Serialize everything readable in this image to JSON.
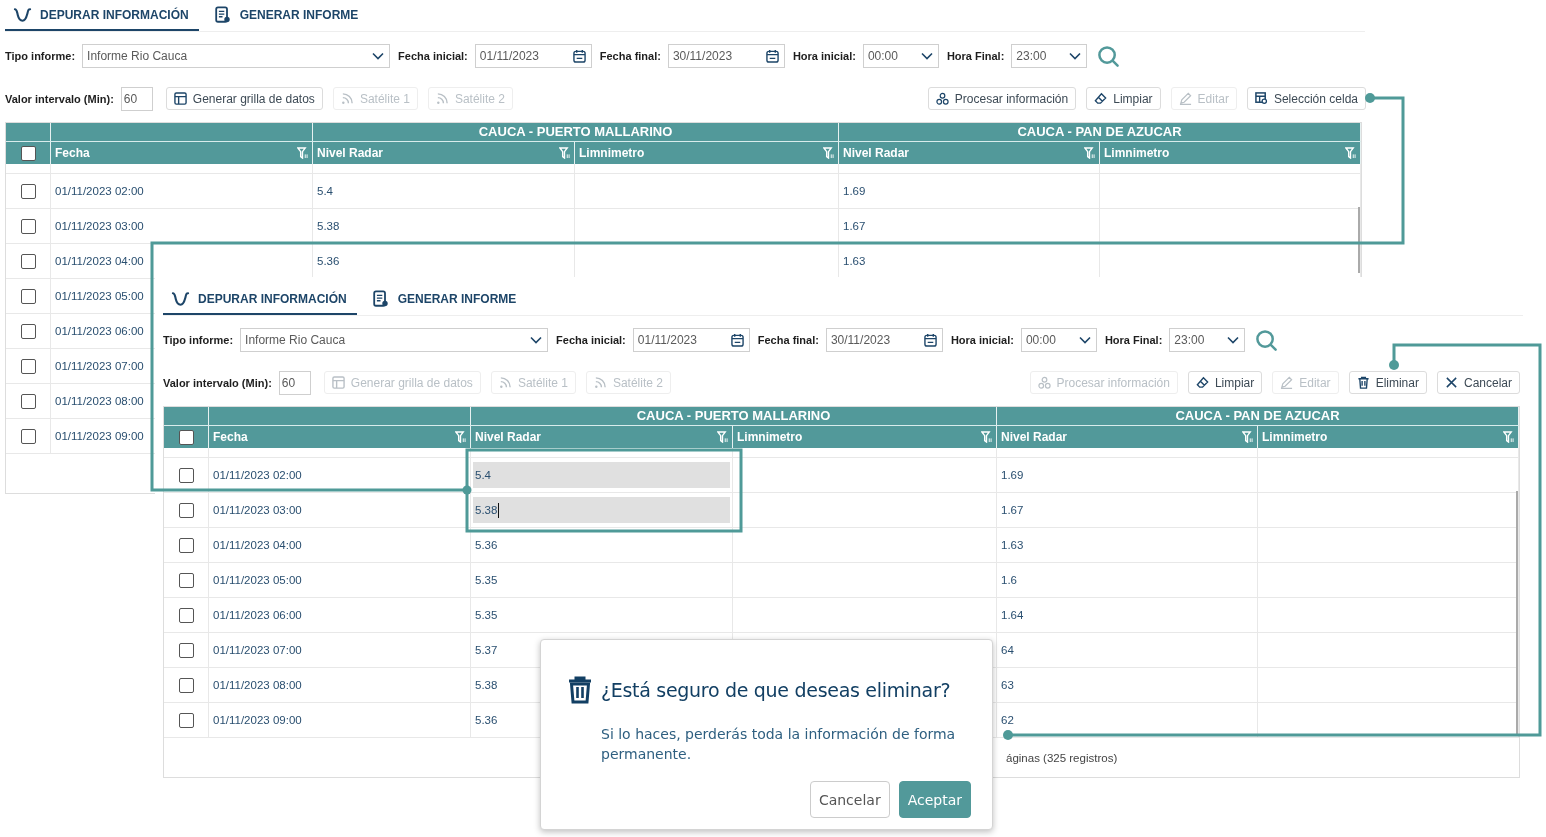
{
  "panels": [
    {
      "tabs": [
        {
          "label": "DEPURAR INFORMACIÓN",
          "selected": true
        },
        {
          "label": "GENERAR INFORME",
          "selected": false
        }
      ],
      "filters": [
        {
          "label": "Tipo informe:",
          "value": "Informe Rio Cauca",
          "kind": "select"
        },
        {
          "label": "Fecha inicial:",
          "value": "01/11/2023",
          "kind": "date"
        },
        {
          "label": "Fecha final:",
          "value": "30/11/2023",
          "kind": "date"
        },
        {
          "label": "Hora inicial:",
          "value": "00:00",
          "kind": "select"
        },
        {
          "label": "Hora Final:",
          "value": "23:00",
          "kind": "select"
        }
      ],
      "interval": {
        "label": "Valor intervalo (Min):",
        "value": "60"
      },
      "left_buttons": [
        {
          "label": "Generar grilla de datos",
          "kind": "grid",
          "disabled": false
        },
        {
          "label": "Satélite 1",
          "kind": "signal",
          "disabled": true
        },
        {
          "label": "Satélite 2",
          "kind": "signal",
          "disabled": true
        }
      ],
      "right_buttons": [
        {
          "label": "Procesar información",
          "kind": "process",
          "disabled": false
        },
        {
          "label": "Limpiar",
          "kind": "eraser",
          "disabled": false
        },
        {
          "label": "Editar",
          "kind": "pencil",
          "disabled": true
        },
        {
          "label": "Selección celda",
          "kind": "select",
          "disabled": false
        }
      ],
      "table": {
        "groups": [
          "CAUCA - PUERTO MALLARINO",
          "CAUCA - PAN DE AZUCAR"
        ],
        "columns": [
          "Fecha",
          "Nivel Radar",
          "Limnimetro",
          "Nivel Radar",
          "Limnimetro"
        ],
        "header_checked": false,
        "rows": [
          {
            "fecha": "01/11/2023 02:00",
            "checked": false,
            "radar_a": {
              "text": "5.4",
              "selected": false,
              "caret": false
            },
            "radar_b": {
              "text": "1.69",
              "selected": false
            }
          },
          {
            "fecha": "01/11/2023 03:00",
            "checked": false,
            "radar_a": {
              "text": "5.38",
              "selected": false,
              "caret": false
            },
            "radar_b": {
              "text": "1.67",
              "selected": false
            }
          },
          {
            "fecha": "01/11/2023 04:00",
            "checked": false,
            "radar_a": {
              "text": "5.36",
              "selected": false,
              "caret": false
            },
            "radar_b": {
              "text": "1.63",
              "selected": false
            }
          },
          {
            "fecha": "01/11/2023 05:00",
            "checked": false
          },
          {
            "fecha": "01/11/2023 06:00",
            "checked": false
          },
          {
            "fecha": "01/11/2023 07:00",
            "checked": false
          },
          {
            "fecha": "01/11/2023 08:00",
            "checked": false
          },
          {
            "fecha": "01/11/2023 09:00",
            "checked": false
          }
        ]
      }
    },
    {
      "tabs": [
        {
          "label": "DEPURAR INFORMACIÓN",
          "selected": true
        },
        {
          "label": "GENERAR INFORME",
          "selected": false
        }
      ],
      "filters": [
        {
          "label": "Tipo informe:",
          "value": "Informe Rio Cauca",
          "kind": "select"
        },
        {
          "label": "Fecha inicial:",
          "value": "01/11/2023",
          "kind": "date"
        },
        {
          "label": "Fecha final:",
          "value": "30/11/2023",
          "kind": "date"
        },
        {
          "label": "Hora inicial:",
          "value": "00:00",
          "kind": "select"
        },
        {
          "label": "Hora Final:",
          "value": "23:00",
          "kind": "select"
        }
      ],
      "interval": {
        "label": "Valor intervalo (Min):",
        "value": "60"
      },
      "left_buttons": [
        {
          "label": "Generar grilla de datos",
          "kind": "grid",
          "disabled": true
        },
        {
          "label": "Satélite 1",
          "kind": "signal",
          "disabled": true
        },
        {
          "label": "Satélite 2",
          "kind": "signal",
          "disabled": true
        }
      ],
      "right_buttons": [
        {
          "label": "Procesar información",
          "kind": "process",
          "disabled": true
        },
        {
          "label": "Limpiar",
          "kind": "eraser",
          "disabled": false
        },
        {
          "label": "Editar",
          "kind": "pencil",
          "disabled": true
        },
        {
          "label": "Eliminar",
          "kind": "trash",
          "disabled": false
        },
        {
          "label": "Cancelar",
          "kind": "close",
          "disabled": false
        }
      ],
      "table": {
        "groups": [
          "CAUCA - PUERTO MALLARINO",
          "CAUCA - PAN DE AZUCAR"
        ],
        "columns": [
          "Fecha",
          "Nivel Radar",
          "Limnimetro",
          "Nivel Radar",
          "Limnimetro"
        ],
        "header_checked": false,
        "rows": [
          {
            "fecha": "01/11/2023 02:00",
            "checked": false,
            "radar_a": {
              "text": "5.4",
              "selected": true,
              "caret": false
            },
            "radar_b": {
              "text": "1.69",
              "selected": false
            }
          },
          {
            "fecha": "01/11/2023 03:00",
            "checked": false,
            "radar_a": {
              "text": "5.38",
              "selected": true,
              "caret": true
            },
            "radar_b": {
              "text": "1.67",
              "selected": false
            }
          },
          {
            "fecha": "01/11/2023 04:00",
            "checked": false,
            "radar_a": {
              "text": "5.36",
              "selected": false,
              "caret": false
            },
            "radar_b": {
              "text": "1.63",
              "selected": false
            }
          },
          {
            "fecha": "01/11/2023 05:00",
            "checked": false,
            "radar_a": {
              "text": "5.35",
              "selected": false,
              "caret": false
            },
            "radar_b": {
              "text": "1.6",
              "selected": false
            }
          },
          {
            "fecha": "01/11/2023 06:00",
            "checked": false,
            "radar_a": {
              "text": "5.35",
              "selected": false,
              "caret": false
            },
            "radar_b": {
              "text": "1.64",
              "selected": false
            }
          },
          {
            "fecha": "01/11/2023 07:00",
            "checked": false,
            "radar_a": {
              "text": "5.37",
              "selected": false,
              "caret": false
            },
            "radar_b": {
              "text": "64",
              "selected": false
            }
          },
          {
            "fecha": "01/11/2023 08:00",
            "checked": false,
            "radar_a": {
              "text": "5.38",
              "selected": false,
              "caret": false
            },
            "radar_b": {
              "text": "63",
              "selected": false
            }
          },
          {
            "fecha": "01/11/2023 09:00",
            "checked": false,
            "radar_a": {
              "text": "5.36",
              "selected": false,
              "caret": false
            },
            "radar_b": {
              "text": "62",
              "selected": false
            }
          }
        ],
        "footer": "áginas (325 registros)"
      }
    }
  ],
  "dialog": {
    "title": "¿Está seguro de que deseas eliminar?",
    "message": "Si lo haces, perderás toda la información de forma permanente.",
    "buttons": [
      {
        "label": "Cancelar",
        "kind": "secondary"
      },
      {
        "label": "Aceptar",
        "kind": "primary"
      }
    ]
  }
}
